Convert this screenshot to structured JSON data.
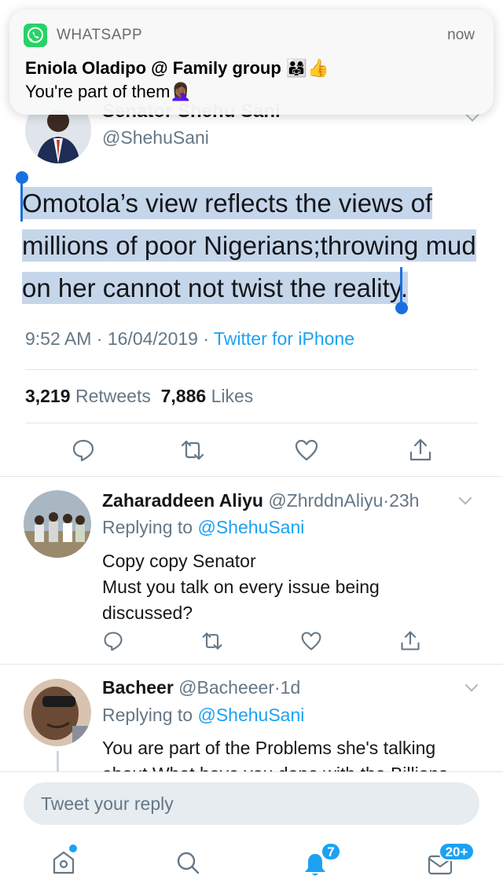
{
  "notification": {
    "app_name": "WHATSAPP",
    "time": "now",
    "title": "Eniola Oladipo @ Family group 👨‍👩‍👧👍",
    "body": "You're part of them🤦🏾‍♀️",
    "icon": "whatsapp-icon"
  },
  "tweet": {
    "author_name_partial": "Senator Shehu Sani",
    "handle": "@ShehuSani",
    "text": "Omotola’s view reflects the views of millions of poor Nigerians;throwing mud on her cannot not twist the reality.",
    "time": "9:52 AM",
    "date": "16/04/2019",
    "separator": "·",
    "source": "Twitter for iPhone",
    "retweets_count": "3,219",
    "retweets_label": "Retweets",
    "likes_count": "7,886",
    "likes_label": "Likes",
    "selection_color": "#c6d6ea"
  },
  "replies": [
    {
      "name": "Zaharaddeen Aliyu",
      "handle": "@ZhrddnAliyu",
      "time": "23h",
      "replying_label": "Replying to",
      "replying_to": "@ShehuSani",
      "text_line1": "Copy copy Senator",
      "text_line2": "Must you talk on every issue being discussed?"
    },
    {
      "name": "Bacheer",
      "handle": "@Bacheeer",
      "time": "1d",
      "replying_label": "Replying to",
      "replying_to": "@ShehuSani",
      "text_line1": "You are part of the Problems she's talking",
      "text_line2": "about What have you done with the Billions"
    }
  ],
  "composer": {
    "placeholder": "Tweet your reply"
  },
  "tabbar": {
    "notifications_badge": "7",
    "messages_badge": "20+"
  },
  "colors": {
    "accent": "#1da1f2",
    "text": "#14171a",
    "secondary": "#657786",
    "whatsapp": "#25d366"
  }
}
